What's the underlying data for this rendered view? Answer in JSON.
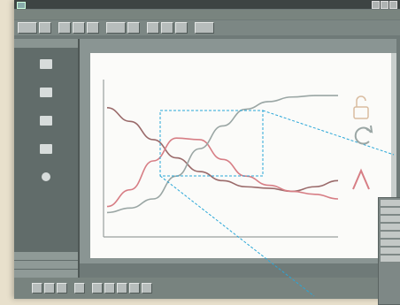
{
  "window": {
    "title": "",
    "controls": [
      "minimize",
      "maximize",
      "close"
    ]
  },
  "menu": {
    "items": [
      "",
      "",
      "",
      "",
      "",
      "",
      "",
      ""
    ]
  },
  "sidebar": {
    "header": "",
    "items": [
      {
        "icon": "chart-icon",
        "label": ""
      },
      {
        "icon": "bar-icon",
        "label": ""
      },
      {
        "icon": "printer-icon",
        "label": ""
      },
      {
        "icon": "document-icon",
        "label": ""
      },
      {
        "icon": "bulb-icon",
        "label": ""
      }
    ],
    "bottom": [
      "",
      "",
      ""
    ]
  },
  "chart_data": {
    "type": "line",
    "x": [
      0,
      1,
      2,
      3,
      4,
      5,
      6,
      7,
      8,
      9,
      10
    ],
    "series": [
      {
        "color": "#9a6a6a",
        "values": [
          8.5,
          7.6,
          6.4,
          5.2,
          4.3,
          3.7,
          3.3,
          3.2,
          3.0,
          3.3,
          3.7
        ]
      },
      {
        "color": "#d77e85",
        "values": [
          2.0,
          3.1,
          5.0,
          6.5,
          6.4,
          5.1,
          4.0,
          3.4,
          3.0,
          2.8,
          2.5
        ]
      },
      {
        "color": "#9aa6a4",
        "values": [
          1.6,
          1.9,
          2.5,
          4.0,
          5.8,
          7.3,
          8.4,
          8.9,
          9.2,
          9.3,
          9.3
        ]
      }
    ],
    "ylim": [
      0,
      10
    ],
    "grid": false
  },
  "annotations": {
    "zoom_box_color": "#2aa7d8",
    "right_glyphs": [
      "lock-icon",
      "refresh-icon",
      "lambda-icon"
    ],
    "right_glyph_colors": [
      "#d9bca0",
      "#9aa6a4",
      "#d77e85"
    ]
  },
  "status": {
    "text": ""
  }
}
